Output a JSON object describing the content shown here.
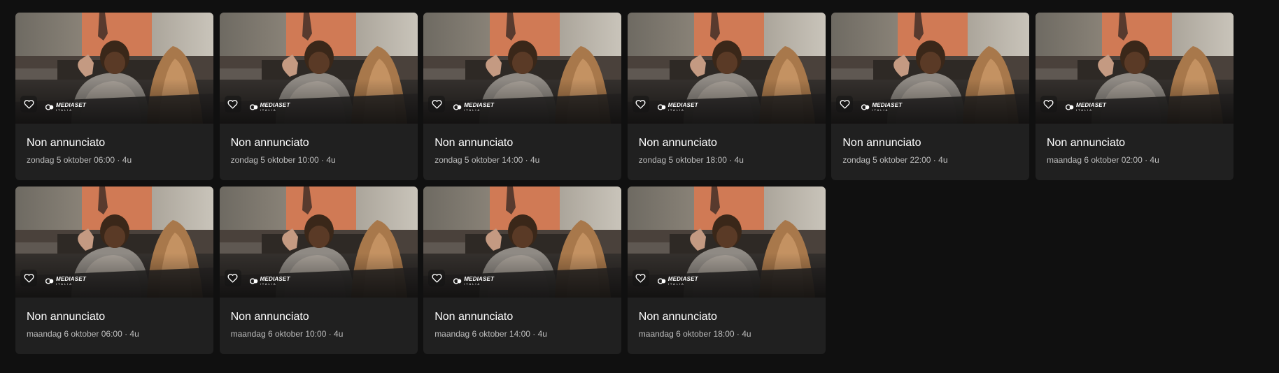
{
  "logo": {
    "brand": "MEDIASET",
    "sub": "ITALIA"
  },
  "programs": [
    {
      "title": "Non annunciato",
      "meta": "zondag 5 oktober 06:00 · 4u"
    },
    {
      "title": "Non annunciato",
      "meta": "zondag 5 oktober 10:00 · 4u"
    },
    {
      "title": "Non annunciato",
      "meta": "zondag 5 oktober 14:00 · 4u"
    },
    {
      "title": "Non annunciato",
      "meta": "zondag 5 oktober 18:00 · 4u"
    },
    {
      "title": "Non annunciato",
      "meta": "zondag 5 oktober 22:00 · 4u"
    },
    {
      "title": "Non annunciato",
      "meta": "maandag 6 oktober 02:00 · 4u"
    },
    {
      "title": "Non annunciato",
      "meta": "maandag 6 oktober 06:00 · 4u"
    },
    {
      "title": "Non annunciato",
      "meta": "maandag 6 oktober 10:00 · 4u"
    },
    {
      "title": "Non annunciato",
      "meta": "maandag 6 oktober 14:00 · 4u"
    },
    {
      "title": "Non annunciato",
      "meta": "maandag 6 oktober 18:00 · 4u"
    }
  ]
}
